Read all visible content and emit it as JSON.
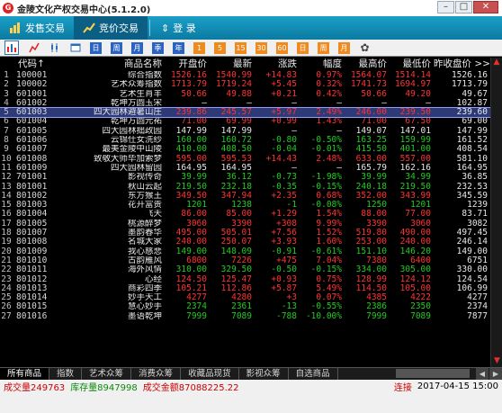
{
  "window": {
    "title": "金陵文化产权交易中心(5.1.2.0)",
    "logo_glyph": "G"
  },
  "toolbar_top": {
    "tabs": [
      {
        "label": "发售交易",
        "icon": "chart-icon"
      },
      {
        "label": "竞价交易",
        "icon": "trend-icon"
      }
    ],
    "login_label": "登  录"
  },
  "icon_toolbar": {
    "items": [
      "kline-chart-icon",
      "line-chart-icon",
      "candle-icon",
      "window-icon",
      "calendar-day-icon",
      "week-icon",
      "month-icon",
      "season-icon",
      "year-icon",
      "min1-icon",
      "min5-icon",
      "min15-icon",
      "min30-icon",
      "min60-icon",
      "day-icon",
      "week2-icon",
      "month2-icon",
      "settings-icon"
    ],
    "labels": [
      "",
      "",
      "",
      "",
      "日",
      "周",
      "月",
      "季",
      "年",
      "1",
      "5",
      "15",
      "30",
      "60",
      "日",
      "周",
      "月",
      ""
    ]
  },
  "table": {
    "headers": [
      "",
      "代码↑",
      "商品名称",
      "开盘价",
      "最新",
      "涨跌",
      "幅度",
      "最高价",
      "最低价",
      "昨收盘价 >>"
    ],
    "selected_index": 4,
    "rows": [
      {
        "idx": "1",
        "code": "100001",
        "name": "综合指数",
        "open": "1526.16",
        "last": "1540.99",
        "chg": "+14.83",
        "pct": "0.97%",
        "high": "1564.07",
        "low": "1514.14",
        "prev": "1526.16",
        "dir": "up"
      },
      {
        "idx": "2",
        "code": "100002",
        "name": "艺术众筹指数",
        "open": "1713.79",
        "last": "1719.24",
        "chg": "+5.45",
        "pct": "0.32%",
        "high": "1741.73",
        "low": "1694.97",
        "prev": "1713.79",
        "dir": "up"
      },
      {
        "idx": "3",
        "code": "601001",
        "name": "艺术生肖羊",
        "open": "50.66",
        "last": "49.88",
        "chg": "+0.21",
        "pct": "0.42%",
        "high": "50.66",
        "low": "49.20",
        "prev": "49.67",
        "dir": "up"
      },
      {
        "idx": "4",
        "code": "601002",
        "name": "乾坤方圆玉宋",
        "open": "—",
        "last": "—",
        "chg": "—",
        "pct": "—",
        "high": "—",
        "low": "—",
        "prev": "102.87",
        "dir": "flat"
      },
      {
        "idx": "5",
        "code": "601003",
        "name": "四大园林避暑山庄",
        "open": "239.86",
        "last": "245.57",
        "chg": "+5.97",
        "pct": "2.49%",
        "high": "246.00",
        "low": "239.50",
        "prev": "239.60",
        "dir": "up"
      },
      {
        "idx": "6",
        "code": "601004",
        "name": "乾坤方圆元祐",
        "open": "71.00",
        "last": "69.99",
        "chg": "+0.99",
        "pct": "1.43%",
        "high": "71.00",
        "low": "67.50",
        "prev": "69.00",
        "dir": "up"
      },
      {
        "idx": "7",
        "code": "601005",
        "name": "四大园林拙政园",
        "open": "147.99",
        "last": "147.99",
        "chg": "—",
        "pct": "—",
        "high": "149.07",
        "low": "147.01",
        "prev": "147.99",
        "dir": "flat"
      },
      {
        "idx": "8",
        "code": "601006",
        "name": "云锦仕女洗纱",
        "open": "160.00",
        "last": "160.72",
        "chg": "-0.80",
        "pct": "-0.50%",
        "high": "163.25",
        "low": "159.99",
        "prev": "161.52",
        "dir": "down"
      },
      {
        "idx": "9",
        "code": "601007",
        "name": "最美金陵中山陵",
        "open": "410.00",
        "last": "408.50",
        "chg": "-0.04",
        "pct": "-0.01%",
        "high": "415.50",
        "low": "401.00",
        "prev": "408.54",
        "dir": "down"
      },
      {
        "idx": "10",
        "code": "601008",
        "name": "致敬大师毕加索梦",
        "open": "595.00",
        "last": "595.53",
        "chg": "+14.43",
        "pct": "2.48%",
        "high": "633.00",
        "low": "557.00",
        "prev": "581.10",
        "dir": "up"
      },
      {
        "idx": "11",
        "code": "601009",
        "name": "四大园林留园",
        "open": "164.95",
        "last": "164.95",
        "chg": "—",
        "pct": "—",
        "high": "165.79",
        "low": "162.16",
        "prev": "164.95",
        "dir": "flat"
      },
      {
        "idx": "12",
        "code": "701001",
        "name": "影视传奇",
        "open": "39.99",
        "last": "36.12",
        "chg": "-0.73",
        "pct": "-1.98%",
        "high": "39.99",
        "low": "34.99",
        "prev": "36.85",
        "dir": "down"
      },
      {
        "idx": "13",
        "code": "801001",
        "name": "秋山云起",
        "open": "219.50",
        "last": "232.18",
        "chg": "-0.35",
        "pct": "-0.15%",
        "high": "240.18",
        "low": "219.50",
        "prev": "232.53",
        "dir": "down"
      },
      {
        "idx": "14",
        "code": "801002",
        "name": "东方猴王",
        "open": "349.50",
        "last": "347.94",
        "chg": "+2.35",
        "pct": "0.68%",
        "high": "352.00",
        "low": "343.99",
        "prev": "345.59",
        "dir": "up"
      },
      {
        "idx": "15",
        "code": "801003",
        "name": "花开富贵",
        "open": "1201",
        "last": "1238",
        "chg": "-1",
        "pct": "-0.08%",
        "high": "1250",
        "low": "1201",
        "prev": "1239",
        "dir": "down"
      },
      {
        "idx": "16",
        "code": "801004",
        "name": "飞天",
        "open": "86.00",
        "last": "85.00",
        "chg": "+1.29",
        "pct": "1.54%",
        "high": "88.00",
        "low": "77.00",
        "prev": "83.71",
        "dir": "up"
      },
      {
        "idx": "17",
        "code": "801005",
        "name": "桃源醉梦",
        "open": "3060",
        "last": "3390",
        "chg": "+308",
        "pct": "9.99%",
        "high": "3390",
        "low": "3060",
        "prev": "3082",
        "dir": "up"
      },
      {
        "idx": "18",
        "code": "801007",
        "name": "墨韵春华",
        "open": "495.00",
        "last": "505.01",
        "chg": "+7.56",
        "pct": "1.52%",
        "high": "519.80",
        "low": "490.00",
        "prev": "497.45",
        "dir": "up"
      },
      {
        "idx": "19",
        "code": "801008",
        "name": "名城大家",
        "open": "240.00",
        "last": "250.07",
        "chg": "+3.93",
        "pct": "1.60%",
        "high": "253.00",
        "low": "240.00",
        "prev": "246.14",
        "dir": "up"
      },
      {
        "idx": "20",
        "code": "801009",
        "name": "我心慈悲",
        "open": "149.00",
        "last": "148.09",
        "chg": "-0.91",
        "pct": "-0.61%",
        "high": "151.10",
        "low": "146.20",
        "prev": "149.00",
        "dir": "down"
      },
      {
        "idx": "21",
        "code": "801010",
        "name": "古韵雁风",
        "open": "6800",
        "last": "7226",
        "chg": "+475",
        "pct": "7.04%",
        "high": "7380",
        "low": "6400",
        "prev": "6751",
        "dir": "up"
      },
      {
        "idx": "22",
        "code": "801011",
        "name": "海外风情",
        "open": "310.00",
        "last": "329.50",
        "chg": "-0.50",
        "pct": "-0.15%",
        "high": "334.00",
        "low": "305.00",
        "prev": "330.00",
        "dir": "down"
      },
      {
        "idx": "23",
        "code": "801012",
        "name": "心经",
        "open": "124.50",
        "last": "125.47",
        "chg": "+0.93",
        "pct": "0.75%",
        "high": "128.99",
        "low": "124.12",
        "prev": "124.54",
        "dir": "up"
      },
      {
        "idx": "24",
        "code": "801013",
        "name": "商彩四季",
        "open": "105.21",
        "last": "112.86",
        "chg": "+5.87",
        "pct": "5.49%",
        "high": "114.50",
        "low": "105.00",
        "prev": "106.99",
        "dir": "up"
      },
      {
        "idx": "25",
        "code": "801014",
        "name": "妙手天工",
        "open": "4277",
        "last": "4280",
        "chg": "+3",
        "pct": "0.07%",
        "high": "4385",
        "low": "4222",
        "prev": "4277",
        "dir": "up"
      },
      {
        "idx": "26",
        "code": "801015",
        "name": "慧心妙手",
        "open": "2374",
        "last": "2361",
        "chg": "-13",
        "pct": "-0.55%",
        "high": "2386",
        "low": "2350",
        "prev": "2374",
        "dir": "down"
      },
      {
        "idx": "27",
        "code": "801016",
        "name": "墨语乾坤",
        "open": "7999",
        "last": "7089",
        "chg": "-788",
        "pct": "-10.00%",
        "high": "7999",
        "low": "7089",
        "prev": "7877",
        "dir": "down"
      }
    ]
  },
  "bottom_tabs": [
    "所有商品",
    "指数",
    "艺术众筹",
    "消费众筹",
    "收藏品现货",
    "影视众筹",
    "自选商品"
  ],
  "status": {
    "volume": "成交量249763",
    "position": "库存量8947998",
    "amount": "成交金额87088225.22",
    "connection": "连接",
    "datetime": "2017-04-15 15:00"
  },
  "colors": {
    "up": "#ff3333",
    "down": "#22cc22",
    "flat": "#e8e8e8",
    "toolbar": "#1aa0c8"
  }
}
